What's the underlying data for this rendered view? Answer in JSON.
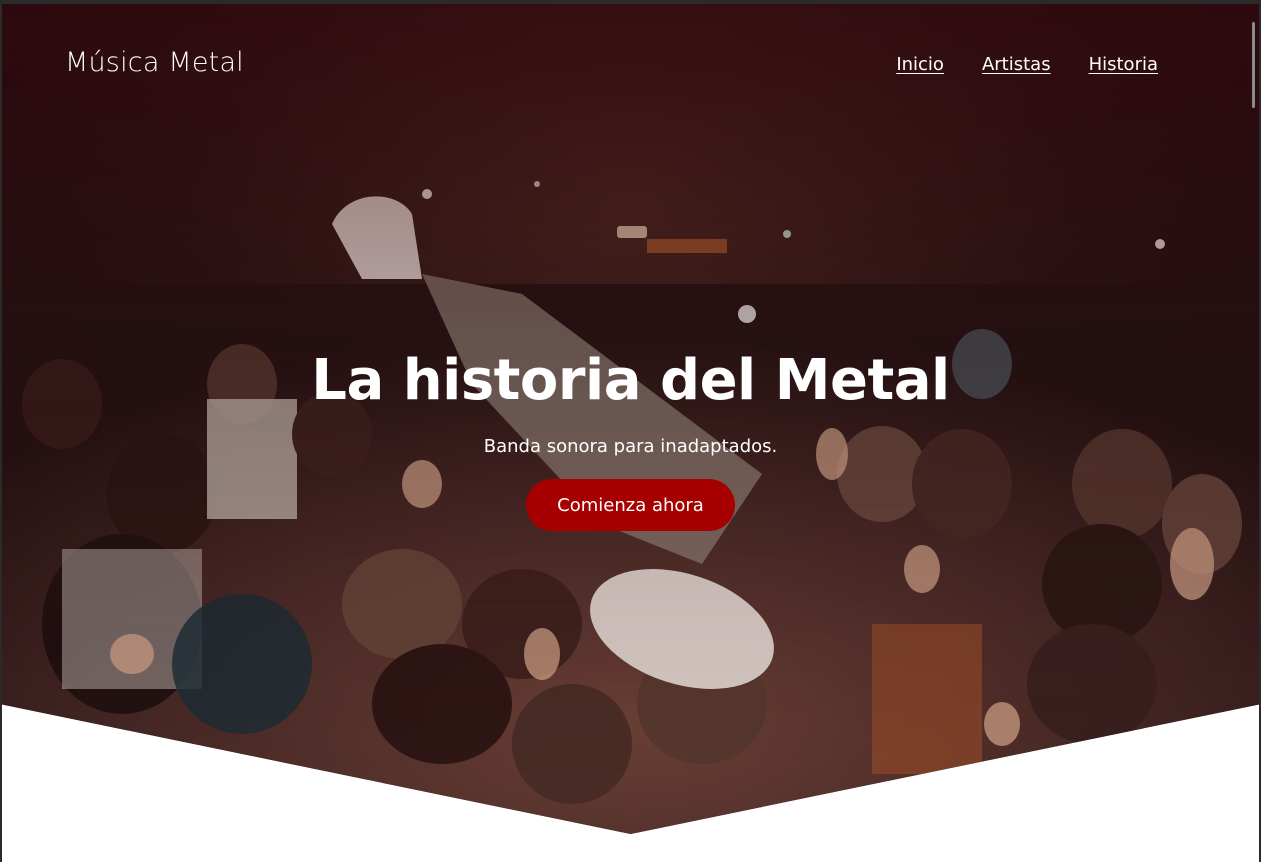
{
  "header": {
    "brand": "Música Metal",
    "nav": [
      {
        "label": "Inicio"
      },
      {
        "label": "Artistas"
      },
      {
        "label": "Historia"
      }
    ]
  },
  "hero": {
    "title": "La historia del Metal",
    "subtitle": "Banda sonora para inadaptados.",
    "cta_label": "Comienza ahora",
    "photo": "concert-crowd-stage-diving",
    "accent_color": "#a60000",
    "overlay_tint": "#37060e"
  }
}
